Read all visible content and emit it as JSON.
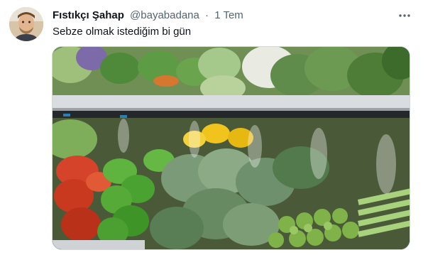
{
  "tweet": {
    "author": {
      "display_name": "Fıstıkçı Şahap",
      "handle": "@bayabadana",
      "separator": "·",
      "timestamp": "1 Tem"
    },
    "text": "Sebze olmak istediğim bi gün",
    "avatar_icon": "person-avatar",
    "more_icon": "more-dots-icon",
    "media": {
      "kind": "photo",
      "subject": "supermarket produce shelf with broccoli, peppers, lettuce and celery under mist sprayers"
    }
  },
  "colors": {
    "name_text": "#0f1419",
    "secondary_text": "#536471",
    "border": "#cfd9de"
  }
}
